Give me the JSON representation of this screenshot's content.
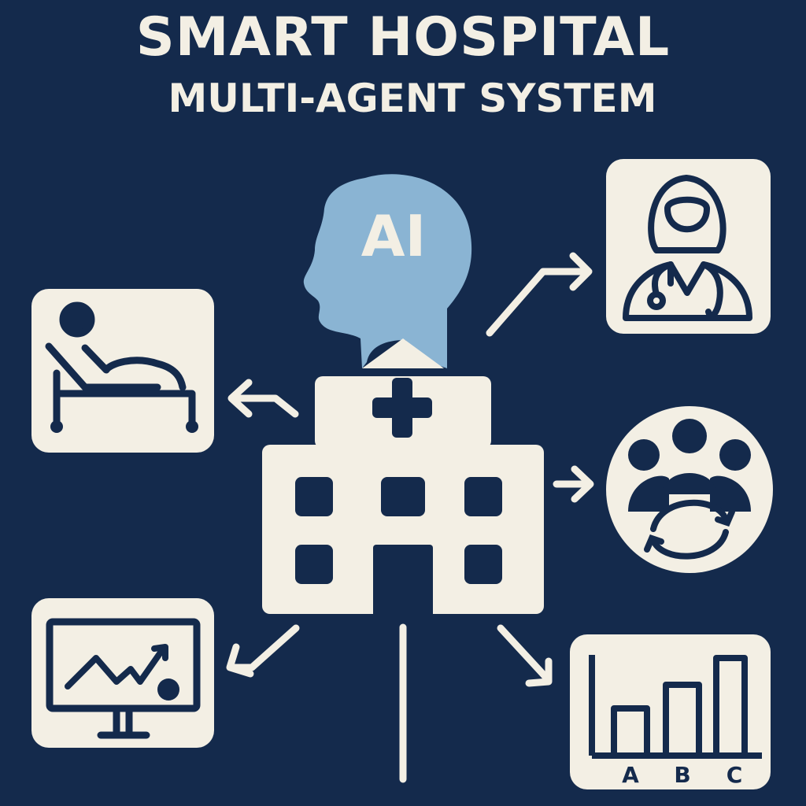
{
  "title": {
    "line1": "SMART HOSPITAL",
    "line2": "MULTI-AGENT SYSTEM"
  },
  "ai_head": {
    "label": "AI",
    "color": "#8ab4d3"
  },
  "colors": {
    "background": "#142a4c",
    "foreground": "#f3efe4"
  },
  "icons": [
    "ai-head-icon",
    "hospital-building-icon",
    "doctor-icon",
    "patient-bed-icon",
    "team-collaboration-icon",
    "vital-monitor-icon",
    "bar-chart-icon"
  ],
  "bar_chart_labels": [
    "A",
    "B",
    "C"
  ]
}
